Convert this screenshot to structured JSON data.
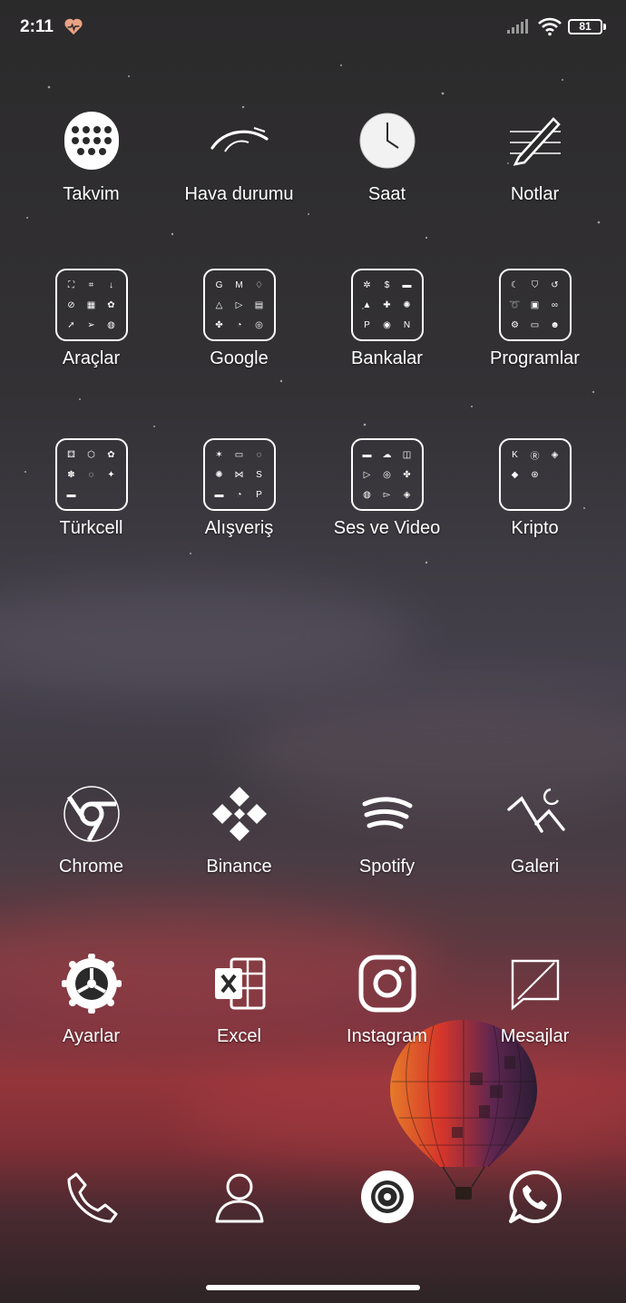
{
  "status": {
    "time": "2:11",
    "battery": "81"
  },
  "rows": [
    [
      {
        "label": "Takvim",
        "icon": "calendar-icon"
      },
      {
        "label": "Hava durumu",
        "icon": "weather-icon"
      },
      {
        "label": "Saat",
        "icon": "clock-icon"
      },
      {
        "label": "Notlar",
        "icon": "notes-icon"
      }
    ],
    [
      {
        "label": "Araçlar",
        "icon": "folder-icon"
      },
      {
        "label": "Google",
        "icon": "folder-icon"
      },
      {
        "label": "Bankalar",
        "icon": "folder-icon"
      },
      {
        "label": "Programlar",
        "icon": "folder-icon"
      }
    ],
    [
      {
        "label": "Türkcell",
        "icon": "folder-icon"
      },
      {
        "label": "Alışveriş",
        "icon": "folder-icon"
      },
      {
        "label": "Ses ve Video",
        "icon": "folder-icon"
      },
      {
        "label": "Kripto",
        "icon": "folder-icon"
      }
    ],
    [
      {
        "label": "Chrome",
        "icon": "chrome-icon"
      },
      {
        "label": "Binance",
        "icon": "binance-icon"
      },
      {
        "label": "Spotify",
        "icon": "spotify-icon"
      },
      {
        "label": "Galeri",
        "icon": "gallery-icon"
      }
    ],
    [
      {
        "label": "Ayarlar",
        "icon": "settings-icon"
      },
      {
        "label": "Excel",
        "icon": "excel-icon"
      },
      {
        "label": "Instagram",
        "icon": "instagram-icon"
      },
      {
        "label": "Mesajlar",
        "icon": "messages-icon"
      }
    ]
  ],
  "dock": [
    {
      "icon": "phone-icon"
    },
    {
      "icon": "contacts-icon"
    },
    {
      "icon": "camera-icon"
    },
    {
      "icon": "whatsapp-icon"
    }
  ]
}
